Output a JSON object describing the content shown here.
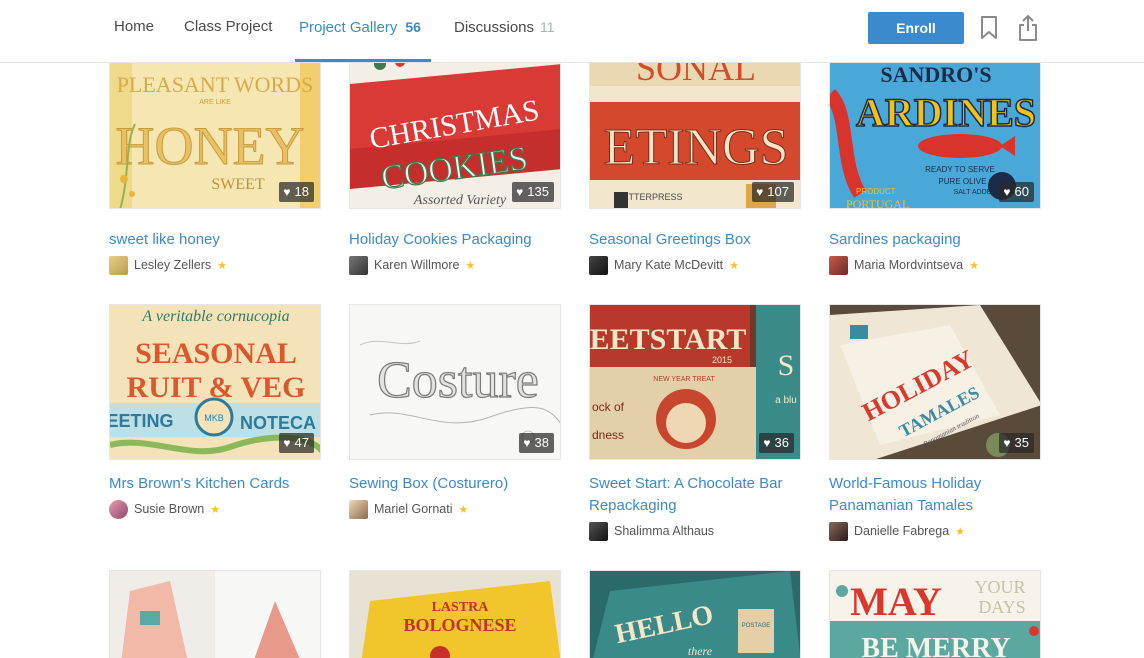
{
  "nav": {
    "tabs": [
      {
        "label": "Home",
        "count": ""
      },
      {
        "label": "Class Project",
        "count": ""
      },
      {
        "label": "Project Gallery",
        "count": "56"
      },
      {
        "label": "Discussions",
        "count": "11"
      }
    ],
    "enroll_label": "Enroll"
  },
  "colors": {
    "accent": "#3b8acd",
    "star": "#f2c230"
  },
  "projects": [
    {
      "title": "sweet like honey",
      "author": "Lesley Zellers",
      "likes": "18",
      "star": true
    },
    {
      "title": "Holiday Cookies Packaging",
      "author": "Karen Willmore",
      "likes": "135",
      "star": true
    },
    {
      "title": "Seasonal Greetings Box",
      "author": "Mary Kate McDevitt",
      "likes": "107",
      "star": true
    },
    {
      "title": "Sardines packaging",
      "author": "Maria Mordvintseva",
      "likes": "60",
      "star": true
    },
    {
      "title": "Mrs Brown's Kitchen Cards",
      "author": "Susie Brown",
      "likes": "47",
      "star": true
    },
    {
      "title": "Sewing Box (Costurero)",
      "author": "Mariel Gornati",
      "likes": "38",
      "star": true
    },
    {
      "title": "Sweet Start: A Chocolate Bar Repackaging",
      "author": "Shalimma Althaus",
      "likes": "36",
      "star": false
    },
    {
      "title": "World-Famous Holiday Panamanian Tamales",
      "author": "Danielle Fabrega",
      "likes": "35",
      "star": true
    }
  ],
  "thumb_text": {
    "honey_top": "PLEASANT WORDS",
    "honey_small": "ARE LIKE",
    "honey_main": "HONEY",
    "honey_sweet": "SWEET",
    "christmas": "CHRISTMAS",
    "cookies": "COOKIES",
    "assorted": "Assorted Variety",
    "sonal": "SONAL",
    "etings": "ETINGS",
    "letterpress": "LETTERPRESS",
    "sandros": "SANDRO'S",
    "ardines": "ARDINES",
    "ready": "READY TO SERVE",
    "olive": "PURE OLIVE OIL",
    "salt": "SALT ADDED",
    "product": "PRODUCT",
    "portugal": "PORTUGAL",
    "cornucopia": "A veritable cornucopia",
    "seasonal": "SEASONAL",
    "fruitveg": "RUIT & VEG",
    "eeting": "EETING",
    "notecards": "NOTECA",
    "mkb": "MKB",
    "costure": "Costure",
    "eetstart": "EETSTART",
    "year": "2015",
    "newyear": "NEW YEAR TREAT",
    "ockof": "ock of",
    "dness": "dness",
    "ablu": "a blu",
    "holiday": "HOLIDAY",
    "tamales": "TAMALES",
    "tradition": "a Panamanian tradition",
    "lastra": "LASTRA",
    "bolognese": "BOLOGNESE",
    "hello": "HELLO",
    "there": "there",
    "postage": "POSTAGE",
    "may": "MAY",
    "your": "YOUR",
    "days": "DAYS",
    "bemerry": "BE MERRY"
  }
}
